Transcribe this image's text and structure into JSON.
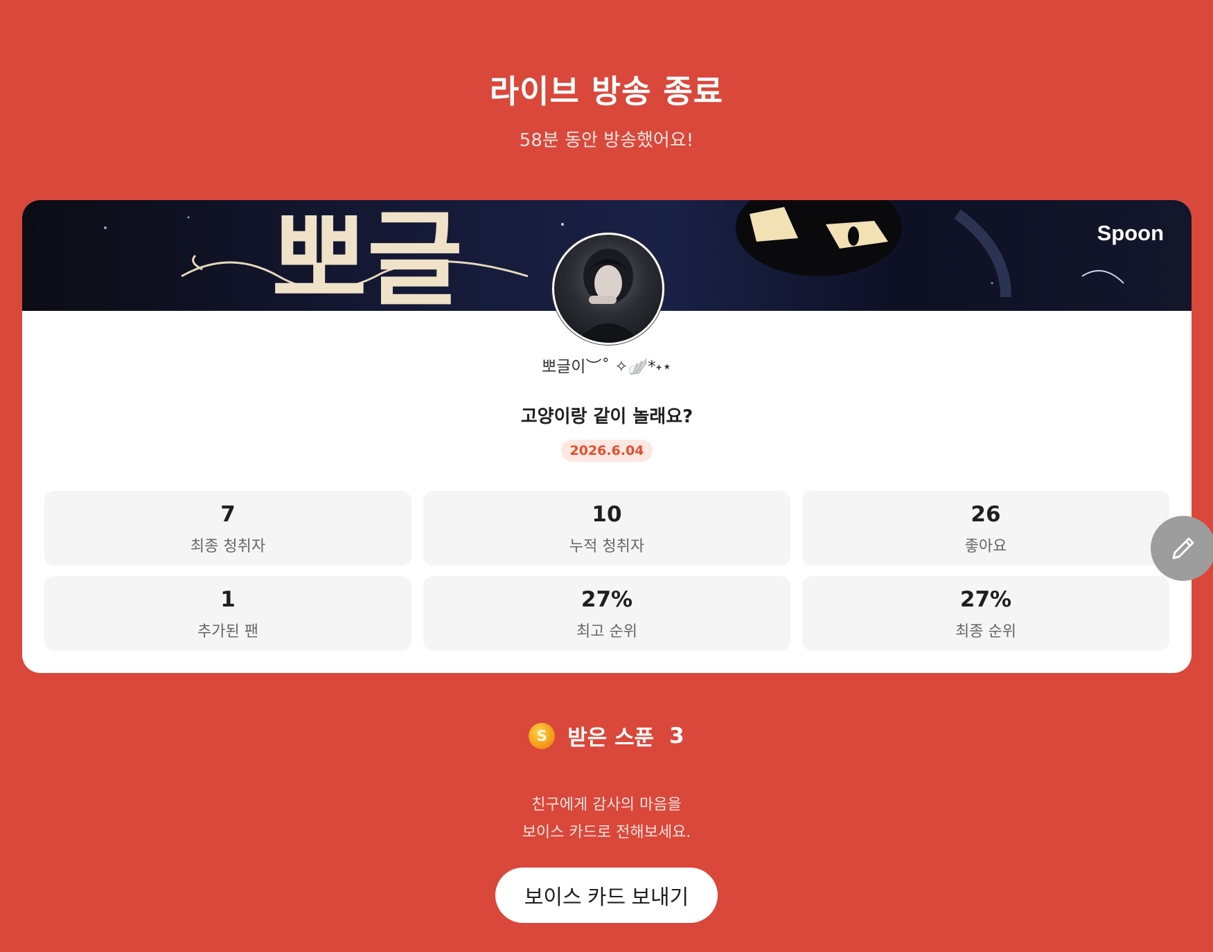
{
  "header": {
    "title": "라이브 방송 종료",
    "subtitle": "58분 동안 방송했어요!"
  },
  "card": {
    "brand": "Spoon",
    "username": "뽀글이︶˚ ✧🪽*˖⋆",
    "live_title": "고양이랑 같이 놀래요?",
    "date": "2026.6.04",
    "stats": [
      {
        "value": "7",
        "label": "최종 청취자"
      },
      {
        "value": "10",
        "label": "누적 청취자"
      },
      {
        "value": "26",
        "label": "좋아요"
      },
      {
        "value": "1",
        "label": "추가된 팬"
      },
      {
        "value": "27%",
        "label": "최고 순위"
      },
      {
        "value": "27%",
        "label": "최종 순위"
      }
    ]
  },
  "spoon": {
    "coin_symbol": "S",
    "label": "받은 스푼",
    "count": "3"
  },
  "voice_card": {
    "message_line1": "친구에게 감사의 마음을",
    "message_line2": "보이스 카드로 전해보세요.",
    "button_label": "보이스 카드 보내기"
  },
  "colors": {
    "background": "#d9483b",
    "accent": "#e2502f",
    "date_badge_bg": "#fde8e1",
    "fab": "#9d9d9d"
  },
  "icons": {
    "edit_fab": "pencil-icon",
    "coin": "spoon-coin-icon"
  }
}
